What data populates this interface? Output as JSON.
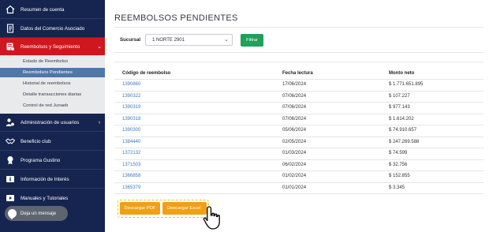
{
  "sidebar": {
    "items": [
      {
        "label": "Resumen de cuenta",
        "icon": "home-icon"
      },
      {
        "label": "Datos del Comercio Asociado",
        "icon": "document-icon"
      },
      {
        "label": "Reembolsos y Seguimiento",
        "icon": "refund-icon",
        "chevron": "⌄"
      },
      {
        "label": "Administración de usuarios",
        "icon": "users-icon",
        "chevron": "‹"
      },
      {
        "label": "Beneficio club",
        "icon": "handshake-icon"
      },
      {
        "label": "Programa Gustino",
        "icon": "award-icon"
      },
      {
        "label": "Información de Interés",
        "icon": "info-icon"
      },
      {
        "label": "Manuales y Tutoriales",
        "icon": "video-icon"
      }
    ],
    "submenu": [
      {
        "label": "Estado de Reembolso"
      },
      {
        "label": "Reembolsos Pendientes"
      },
      {
        "label": "Historial de reembolsos"
      },
      {
        "label": "Detalle transacciones diarias"
      },
      {
        "label": "Control de red Junaeb"
      }
    ],
    "chat_label": "Deja un mensaje"
  },
  "main": {
    "title": "REEMBOLSOS PENDIENTES",
    "filter": {
      "label": "Sucursal",
      "selected": "1 NORTE 2901",
      "button": "Filtrar"
    },
    "table": {
      "headers": [
        "Código de reembolso",
        "Fecha lectura",
        "Monto neto"
      ],
      "rows": [
        [
          "1390860",
          "17/06/2024",
          "$ 1.771.651.895"
        ],
        [
          "1390322",
          "07/06/2024",
          "$ 107.227"
        ],
        [
          "1390319",
          "07/06/2024",
          "$ 977.143"
        ],
        [
          "1390318",
          "07/06/2024",
          "$ 1.614.202"
        ],
        [
          "1390300",
          "05/06/2024",
          "$ 74.910.657"
        ],
        [
          "1384440",
          "02/05/2024",
          "$ 247.269.588"
        ],
        [
          "1372132",
          "01/03/2024",
          "$ 74.599"
        ],
        [
          "1371503",
          "06/02/2024",
          "$ 32.756"
        ],
        [
          "1366858",
          "01/02/2024",
          "$ 152.855"
        ],
        [
          "1365379",
          "01/01/2024",
          "$ 3.345"
        ]
      ]
    },
    "downloads": {
      "pdf": "Descargar PDF",
      "excel": "Descargar Excel"
    }
  },
  "colors": {
    "sidebar_bg": "#15254f",
    "active_red": "#d0161f",
    "submenu_active": "#4f77a8",
    "link_blue": "#3d7bbf",
    "filter_green": "#21a05a",
    "download_orange": "#f0a016"
  }
}
